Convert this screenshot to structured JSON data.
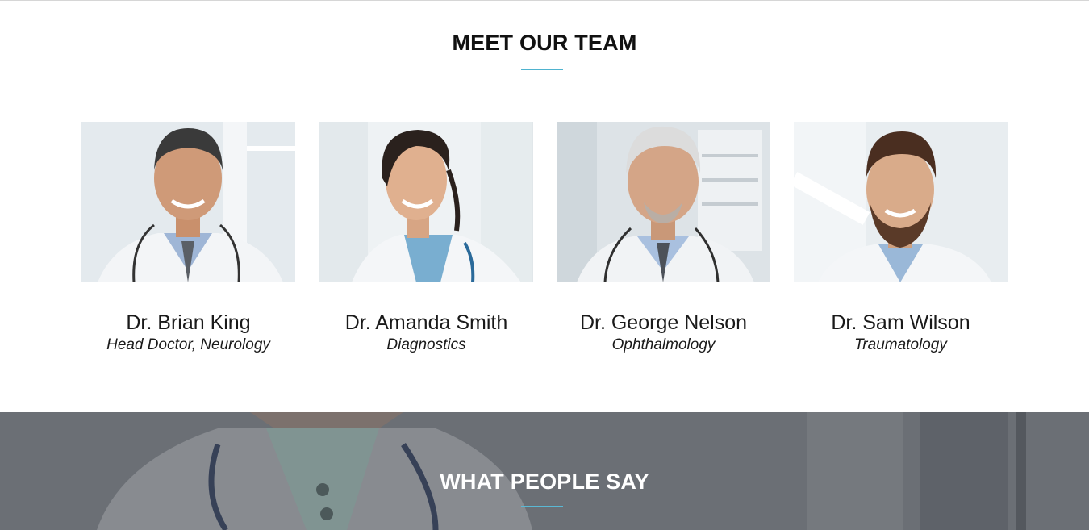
{
  "team": {
    "title": "MEET OUR TEAM",
    "accent_color": "#4fb3cf",
    "members": [
      {
        "name": "Dr. Brian King",
        "role": "Head Doctor, Neurology",
        "photo_icon": "doctor-portrait-brian-king"
      },
      {
        "name": "Dr. Amanda Smith",
        "role": "Diagnostics",
        "photo_icon": "doctor-portrait-amanda-smith"
      },
      {
        "name": "Dr. George Nelson",
        "role": "Ophthalmology",
        "photo_icon": "doctor-portrait-george-nelson"
      },
      {
        "name": "Dr. Sam Wilson",
        "role": "Traumatology",
        "photo_icon": "doctor-portrait-sam-wilson"
      }
    ]
  },
  "testimonials": {
    "title": "WHAT PEOPLE SAY",
    "overlay_color": "#6d7177"
  }
}
